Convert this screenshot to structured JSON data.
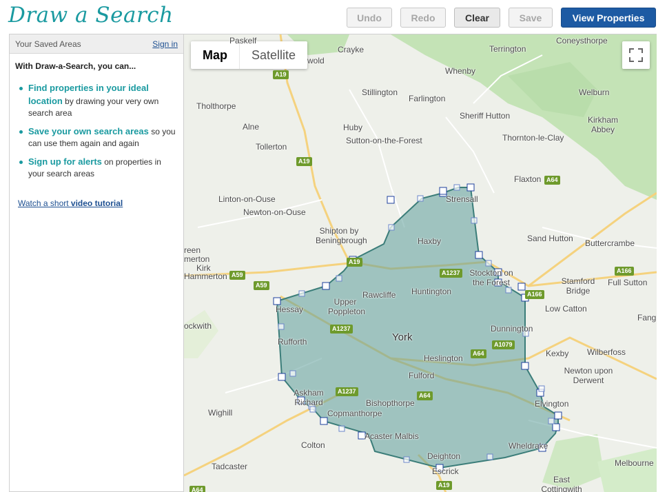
{
  "header": {
    "logo": "Draw a Search",
    "buttons": {
      "undo": "Undo",
      "redo": "Redo",
      "clear": "Clear",
      "save": "Save",
      "view": "View Properties"
    }
  },
  "sidebar": {
    "title": "Your Saved Areas",
    "signin": "Sign in",
    "intro": "With Draw-a-Search, you can...",
    "features": [
      {
        "strong": "Find properties in your ideal location",
        "rest": " by drawing your very own search area"
      },
      {
        "strong": "Save your own search areas",
        "rest": " so you can use them again and again"
      },
      {
        "strong": "Sign up for alerts",
        "rest": " on properties in your search areas"
      }
    ],
    "tutorial_prefix": "Watch a short ",
    "tutorial_link": "video tutorial"
  },
  "map": {
    "type_buttons": [
      "Map",
      "Satellite"
    ],
    "colors": {
      "area_fill": "#5f9e9b",
      "area_stroke": "#3b7d79",
      "vertex": "#1d3f9c",
      "green": "#b5dbab",
      "road": "#f7d58a"
    },
    "places": {
      "paskelf": "Paskelf",
      "crayke": "Crayke",
      "terrington": "Terrington",
      "coneysthorpe": "Coneysthorpe",
      "wold": "wold",
      "whenby": "Whenby",
      "stillington": "Stillington",
      "farlington": "Farlington",
      "welburn": "Welburn",
      "tholthorpe": "Tholthorpe",
      "sheriff_hutton": "Sheriff Hutton",
      "kirkham_abbey": "Kirkham Abbey",
      "alne": "Alne",
      "huby": "Huby",
      "sutton_forest": "Sutton-on-the-Forest",
      "thornton_clay": "Thornton-le-Clay",
      "tollerton": "Tollerton",
      "flaxton": "Flaxton",
      "strensall": "Strensall",
      "linton": "Linton-on-Ouse",
      "newton_ouse": "Newton-on-Ouse",
      "shipton": "Shipton by Beningbrough",
      "haxby": "Haxby",
      "sand_hutton": "Sand Hutton",
      "buttercrambe": "Buttercrambe",
      "green": "reen",
      "marton": "merton",
      "kirk": "Kirk",
      "hammerton": "Hammerton",
      "stockton": "Stockton on the Forest",
      "stamford": "Stamford Bridge",
      "full_sutton": "Full Sutton",
      "rawcliffe": "Rawcliffe",
      "huntington": "Huntington",
      "upper_poppleton": "Upper Poppleton",
      "hessay": "Hessay",
      "low_catton": "Low Catton",
      "tockwith": "ockwith",
      "york": "York",
      "dunnington": "Dunnington",
      "fang": "Fang",
      "rufforth": "Rufforth",
      "heslington": "Heslington",
      "kexby": "Kexby",
      "wilberfoss": "Wilberfoss",
      "fulford": "Fulford",
      "newton_derwent": "Newton upon Derwent",
      "askham": "Askham Richard",
      "bishopthorpe": "Bishopthorpe",
      "elvington": "Elvington",
      "wighill": "Wighill",
      "copmanthorpe": "Copmanthorpe",
      "acaster": "Acaster Malbis",
      "colton": "Colton",
      "wheldrake": "Wheldrake",
      "deighton": "Deighton",
      "melbourne": "Melbourne",
      "tadcaster": "Tadcaster",
      "escrick": "Escrick",
      "east_cottingwith": "East Cottingwith"
    },
    "roads": {
      "a19a": "A19",
      "a19b": "A19",
      "a64a": "A64",
      "a59a": "A59",
      "a59b": "A59",
      "a1237a": "A1237",
      "a1237b": "A1237",
      "a1237c": "A1237",
      "a166a": "A166",
      "a166b": "A166",
      "a1079": "A1079",
      "a64b": "A64",
      "a64c": "A64",
      "a19c": "A19",
      "a64d": "A64",
      "a19d": "A19"
    }
  }
}
